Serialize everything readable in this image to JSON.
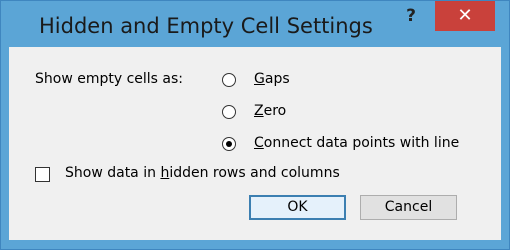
{
  "dialog": {
    "title": "Hidden and Empty Cell Settings",
    "help_glyph": "?",
    "close_glyph": "✕"
  },
  "empty_cells": {
    "label": "Show empty cells as:",
    "options": [
      {
        "label_first": "G",
        "label_rest": "aps",
        "selected": false
      },
      {
        "label_first": "Z",
        "label_rest": "ero",
        "selected": false
      },
      {
        "label_first": "C",
        "label_rest": "onnect data points with line",
        "selected": true
      }
    ]
  },
  "hidden_data": {
    "label_pre": "Show data in ",
    "label_ul": "h",
    "label_post": "idden rows and columns",
    "checked": false
  },
  "buttons": {
    "ok": "OK",
    "cancel": "Cancel"
  },
  "colors": {
    "titlebar": "#5ba5d6",
    "close": "#c9413b",
    "client": "#f0f0f0"
  }
}
